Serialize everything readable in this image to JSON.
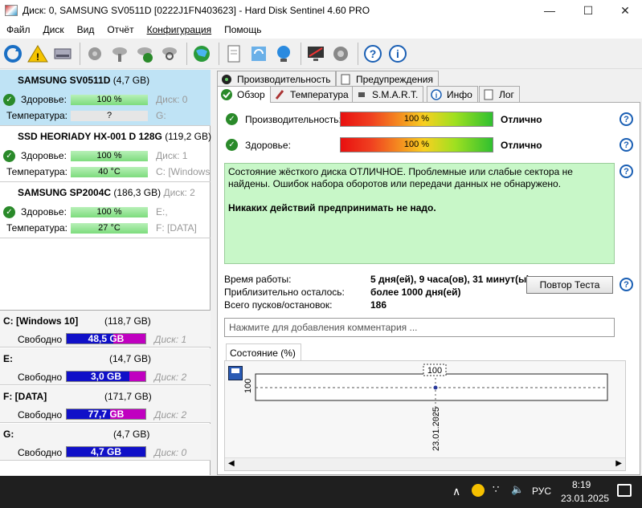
{
  "window": {
    "title": "Диск: 0, SAMSUNG SV0511D [0222J1FN403623]  -  Hard Disk Sentinel 4.60 PRO"
  },
  "menu": [
    "Файл",
    "Диск",
    "Вид",
    "Отчёт",
    "Конфигурация",
    "Помощь"
  ],
  "disks": [
    {
      "name": "SAMSUNG SV0511D",
      "size": "(4,7 GB)",
      "health_label": "Здоровье:",
      "health": "100 %",
      "disk_ref": "Диск: 0",
      "temp_label": "Температура:",
      "temp": "?",
      "vol_ref": "G:"
    },
    {
      "name": "SSD HEORIADY HX-001 D 128G",
      "size": "(119,2 GB)",
      "health_label": "Здоровье:",
      "health": "100 %",
      "disk_ref": "Диск: 1",
      "temp_label": "Температура:",
      "temp": "40 °C",
      "vol_ref": "C: [Windows"
    },
    {
      "name": "SAMSUNG SP2004C",
      "size": "(186,3 GB)",
      "disk_num": "Диск: 2",
      "health_label": "Здоровье:",
      "health": "100 %",
      "disk_ref": "E:,",
      "temp_label": "Температура:",
      "temp": "27 °C",
      "vol_ref": "F: [DATA]"
    }
  ],
  "volumes": [
    {
      "name": "C: [Windows 10]",
      "size": "(118,7 GB)",
      "free_label": "Свободно",
      "free": "48,5 GB",
      "free_pct": 41,
      "disk": "Диск: 1"
    },
    {
      "name": "E:",
      "size": "(14,7 GB)",
      "free_label": "Свободно",
      "free": "3,0 GB",
      "free_pct": 20,
      "disk": "Диск: 2"
    },
    {
      "name": "F: [DATA]",
      "size": "(171,7 GB)",
      "free_label": "Свободно",
      "free": "77,7 GB",
      "free_pct": 45,
      "disk": "Диск: 2"
    },
    {
      "name": "G:",
      "size": "(4,7 GB)",
      "free_label": "Свободно",
      "free": "4,7 GB",
      "free_pct": 0,
      "disk": "Диск: 0"
    }
  ],
  "tabs_top": [
    "Производительность",
    "Предупреждения"
  ],
  "tabs_bottom": [
    "Обзор",
    "Температура",
    "S.M.A.R.T.",
    "Инфо",
    "Лог"
  ],
  "overview": {
    "perf_label": "Производительность:",
    "perf_value": "100 %",
    "perf_rating": "Отлично",
    "health_label": "Здоровье:",
    "health_value": "100 %",
    "health_rating": "Отлично",
    "status_line1": "Состояние жёсткого диска ОТЛИЧНОЕ. Проблемные или слабые сектора не найдены. Ошибок набора оборотов или передачи данных не обнаружено.",
    "status_line2": "Никаких действий предпринимать не надо.",
    "uptime_label": "Время работы:",
    "uptime": "5 дня(ей), 9 часа(ов), 31 минут(ы)",
    "remaining_label": "Приблизительно осталось:",
    "remaining": "более 1000 дня(ей)",
    "starts_label": "Всего пусков/остановок:",
    "starts": "186",
    "repeat_button": "Повтор Теста",
    "comment_placeholder": "Нажмите для добавления комментария ..."
  },
  "chart_tab": "Состояние (%)",
  "chart_data": {
    "type": "line",
    "x": [
      "23.01.2025"
    ],
    "values": [
      100
    ],
    "ylabel": "100",
    "point_label": "100"
  },
  "taskbar": {
    "lang": "РУС",
    "time": "8:19",
    "date": "23.01.2025"
  }
}
